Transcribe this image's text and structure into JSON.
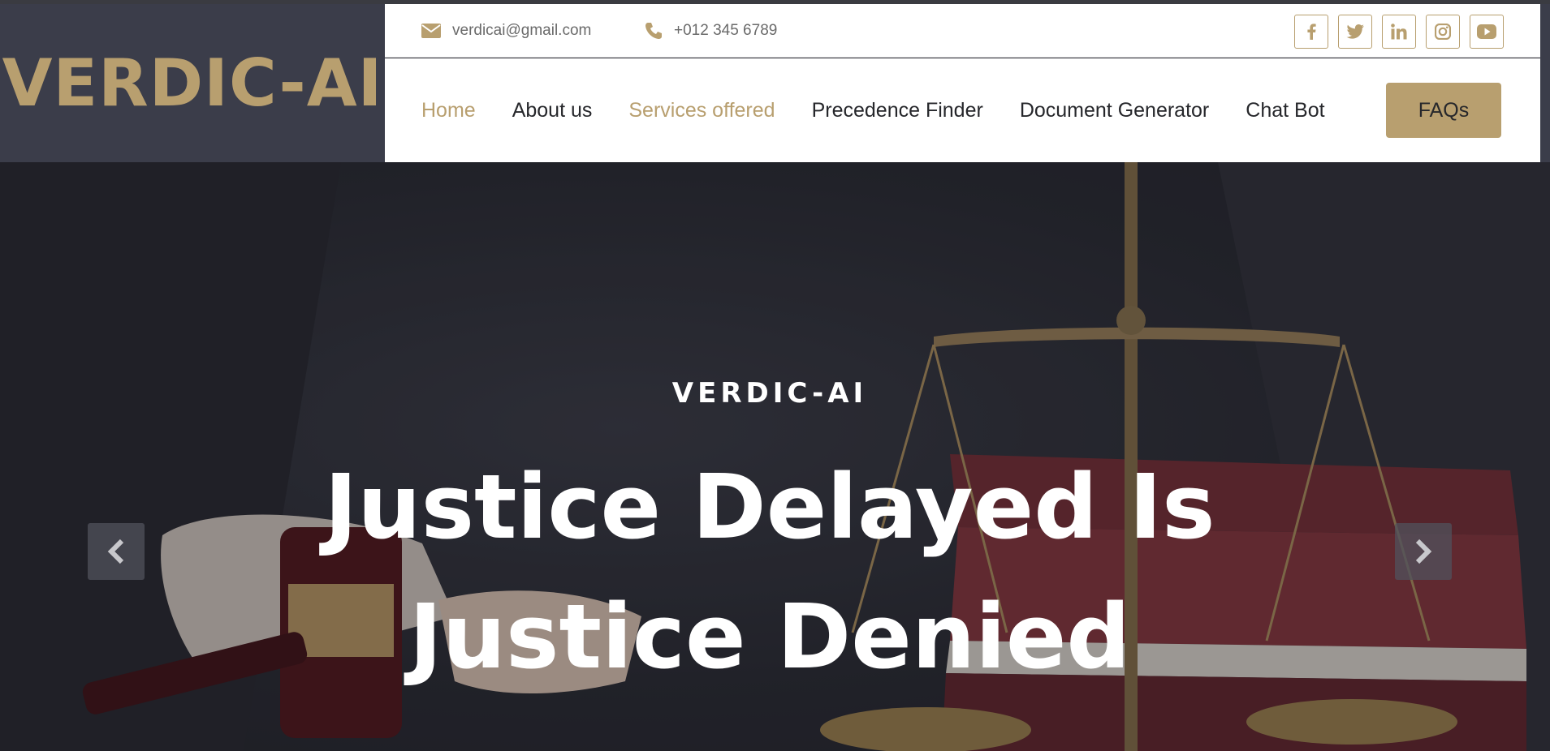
{
  "brand": {
    "name": "VERDIC-AI"
  },
  "topbar": {
    "email": "verdicai@gmail.com",
    "phone": "+012 345 6789",
    "socials": [
      {
        "icon": "facebook-icon",
        "glyph": "f"
      },
      {
        "icon": "twitter-icon",
        "glyph": "t"
      },
      {
        "icon": "linkedin-icon",
        "glyph": "in"
      },
      {
        "icon": "instagram-icon",
        "glyph": "ig"
      },
      {
        "icon": "youtube-icon",
        "glyph": "yt"
      }
    ]
  },
  "nav": {
    "items": [
      {
        "label": "Home",
        "active": true
      },
      {
        "label": "About us",
        "active": false
      },
      {
        "label": "Services offered",
        "active": true
      },
      {
        "label": "Precedence Finder",
        "active": false
      },
      {
        "label": "Document Generator",
        "active": false
      },
      {
        "label": "Chat Bot",
        "active": false
      }
    ],
    "cta": "FAQs"
  },
  "hero": {
    "eyebrow": "VERDIC-AI",
    "headline_line1": "Justice Delayed Is",
    "headline_line2": "Justice Denied"
  },
  "colors": {
    "accent": "#b89f6f",
    "dark": "#3b3d4a"
  }
}
